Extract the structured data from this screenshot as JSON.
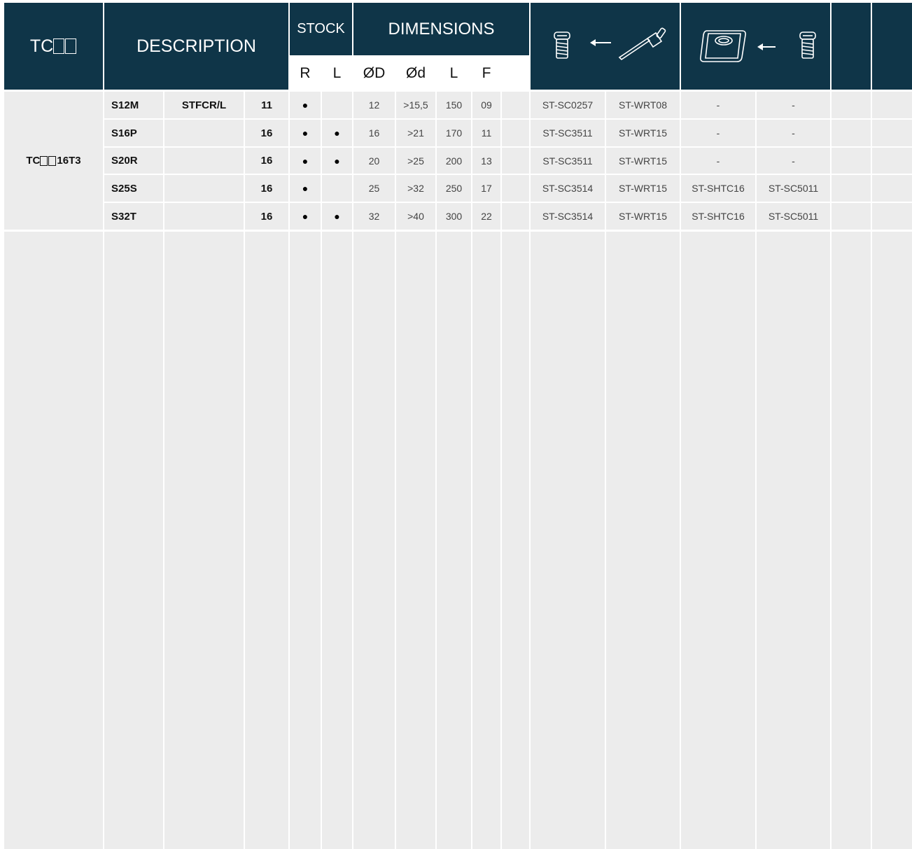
{
  "header": {
    "tc_label": "TC",
    "description": "DESCRIPTION",
    "stock": "STOCK",
    "dimensions": "DIMENSIONS",
    "sub_r": "R",
    "sub_l": "L",
    "sub_od": "ØD",
    "sub_id": "Ød",
    "sub_len": "L",
    "sub_f": "F",
    "icons": [
      "screw-icon",
      "left-arrow-icon",
      "torx-wrench-icon",
      "square-shim-icon",
      "left-arrow-icon",
      "screw-icon"
    ]
  },
  "group_label": "16T3",
  "rows": [
    {
      "code": "S12M",
      "type": "STFCR/L",
      "size": "11",
      "r": "●",
      "l": "",
      "od": "12",
      "id": ">15,5",
      "len": "150",
      "f": "09",
      "screw": "ST-SC0257",
      "key": "ST-WRT08",
      "shim": "-",
      "shim_screw": "-"
    },
    {
      "code": "S16P",
      "type": "",
      "size": "16",
      "r": "●",
      "l": "●",
      "od": "16",
      "id": ">21",
      "len": "170",
      "f": "11",
      "screw": "ST-SC3511",
      "key": "ST-WRT15",
      "shim": "-",
      "shim_screw": "-"
    },
    {
      "code": "S20R",
      "type": "",
      "size": "16",
      "r": "●",
      "l": "●",
      "od": "20",
      "id": ">25",
      "len": "200",
      "f": "13",
      "screw": "ST-SC3511",
      "key": "ST-WRT15",
      "shim": "-",
      "shim_screw": "-"
    },
    {
      "code": "S25S",
      "type": "",
      "size": "16",
      "r": "●",
      "l": "",
      "od": "25",
      "id": ">32",
      "len": "250",
      "f": "17",
      "screw": "ST-SC3514",
      "key": "ST-WRT15",
      "shim": "ST-SHTC16",
      "shim_screw": "ST-SC5011"
    },
    {
      "code": "S32T",
      "type": "",
      "size": "16",
      "r": "●",
      "l": "●",
      "od": "32",
      "id": ">40",
      "len": "300",
      "f": "22",
      "screw": "ST-SC3514",
      "key": "ST-WRT15",
      "shim": "ST-SHTC16",
      "shim_screw": "ST-SC5011"
    }
  ],
  "colors": {
    "header_bg": "#0f3548",
    "cell_bg": "#ececec",
    "grid": "#ffffff"
  }
}
